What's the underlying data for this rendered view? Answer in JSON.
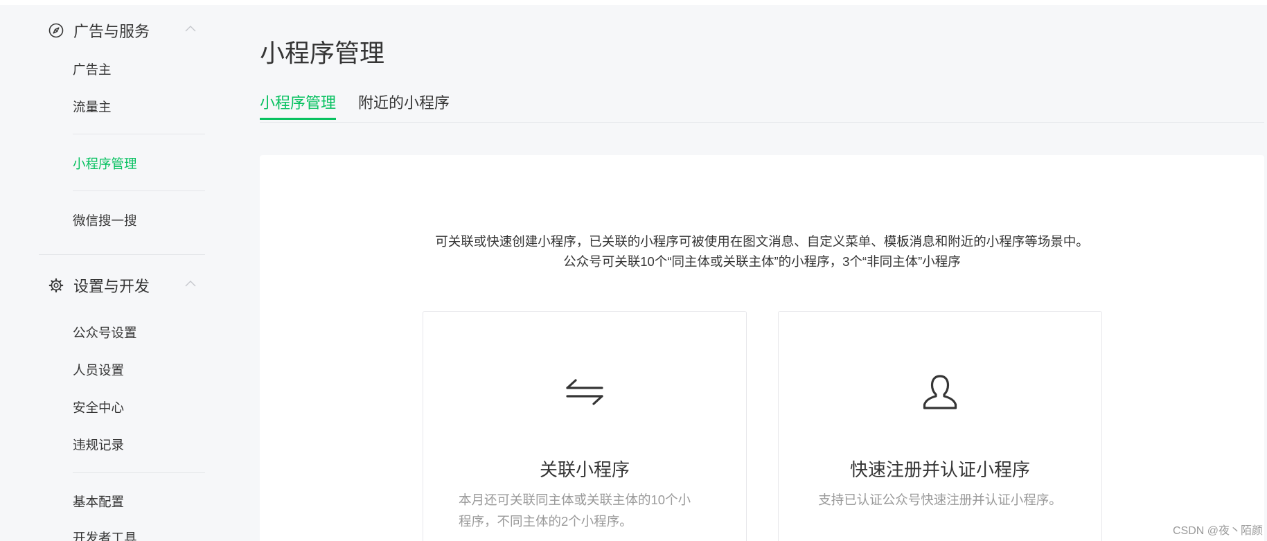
{
  "sidebar": {
    "sections": [
      {
        "title": "广告与服务",
        "icon": "compass-icon"
      },
      {
        "title": "设置与开发",
        "icon": "gear-icon"
      }
    ],
    "items": [
      "广告主",
      "流量主",
      "小程序管理",
      "微信搜一搜",
      "公众号设置",
      "人员设置",
      "安全中心",
      "违规记录",
      "基本配置",
      "开发者工具"
    ],
    "active_item": "小程序管理"
  },
  "main": {
    "title": "小程序管理",
    "tabs": [
      {
        "label": "小程序管理",
        "active": true
      },
      {
        "label": "附近的小程序",
        "active": false
      }
    ],
    "description": [
      "可关联或快速创建小程序，已关联的小程序可被使用在图文消息、自定义菜单、模板消息和附近的小程序等场景中。",
      "公众号可关联10个“同主体或关联主体”的小程序，3个“非同主体”小程序"
    ],
    "cards": [
      {
        "icon": "swap-arrows-icon",
        "title": "关联小程序",
        "desc_lines": [
          "本月还可关联同主体或关联主体的10个小",
          "程序，不同主体的2个小程序。"
        ]
      },
      {
        "icon": "user-icon",
        "title": "快速注册并认证小程序",
        "desc_lines": [
          "支持已认证公众号快速注册并认证小程序。"
        ]
      }
    ]
  },
  "watermark": "CSDN @夜丶陌颜",
  "colors": {
    "accent": "#07c160",
    "background": "#f6f7f9",
    "text": "#353535",
    "muted": "#9a9a9a"
  }
}
